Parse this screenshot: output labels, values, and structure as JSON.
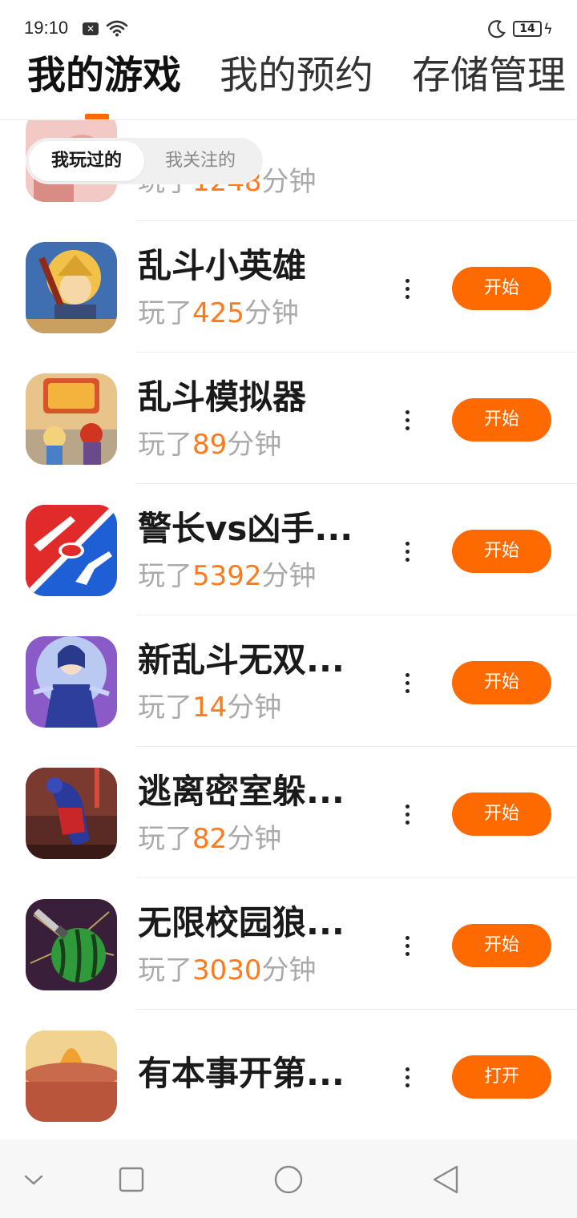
{
  "status_bar": {
    "time": "19:10",
    "battery": "14"
  },
  "tabs": [
    {
      "label": "我的游戏"
    },
    {
      "label": "我的预约"
    },
    {
      "label": "存储管理"
    }
  ],
  "filter": {
    "active": "我玩过的",
    "inactive": "我关注的"
  },
  "partial_row": {
    "prefix": "玩了",
    "minutes": "1248",
    "suffix": "分钟"
  },
  "games": [
    {
      "name": "乱斗小英雄",
      "prefix": "玩了",
      "minutes": "425",
      "suffix": "分钟",
      "action": "开始",
      "icon": "hero-warrior-icon"
    },
    {
      "name": "乱斗模拟器",
      "prefix": "玩了",
      "minutes": "89",
      "suffix": "分钟",
      "action": "开始",
      "icon": "brawl-simulator-icon"
    },
    {
      "name": "警长vs凶手...",
      "prefix": "玩了",
      "minutes": "5392",
      "suffix": "分钟",
      "action": "开始",
      "icon": "knife-vs-gun-icon"
    },
    {
      "name": "新乱斗无双...",
      "prefix": "玩了",
      "minutes": "14",
      "suffix": "分钟",
      "action": "开始",
      "icon": "blue-warrior-icon"
    },
    {
      "name": "逃离密室躲...",
      "prefix": "玩了",
      "minutes": "82",
      "suffix": "分钟",
      "action": "开始",
      "icon": "escape-room-icon"
    },
    {
      "name": "无限校园狼...",
      "prefix": "玩了",
      "minutes": "3030",
      "suffix": "分钟",
      "action": "开始",
      "icon": "watermelon-knife-icon"
    },
    {
      "name": "有本事开第...",
      "action": "打开",
      "icon": "desert-scene-icon"
    }
  ],
  "colors": {
    "accent": "#ff6a00",
    "minutes": "#ff7a1a",
    "muted": "#aaaaaa"
  }
}
